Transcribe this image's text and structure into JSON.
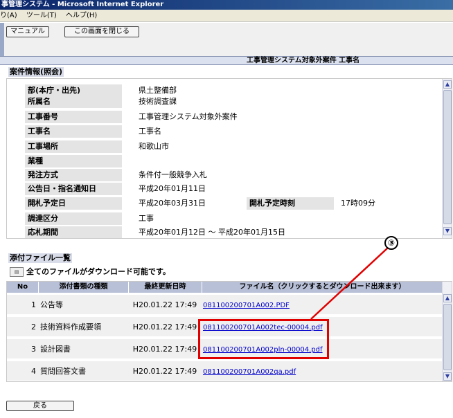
{
  "window": {
    "title": "事管理システム - Microsoft Internet Explorer"
  },
  "menu": [
    "り(A)",
    "ツール(T)",
    "ヘルプ(H)"
  ],
  "toolbar": {
    "manual_label": "マニュアル",
    "close_label": "この画面を閉じる"
  },
  "header": {
    "system_title": "工事管理システム対象外案件 工事名"
  },
  "case_info": {
    "title": "案件情報(照会)",
    "rows": [
      {
        "label": "部(本庁・出先)",
        "value": "県土整備部"
      },
      {
        "label": "所属名",
        "value": "技術調査課"
      },
      {
        "label": "工事番号",
        "value": "工事管理システム対象外案件"
      },
      {
        "label": "工事名",
        "value": "工事名"
      },
      {
        "label": "工事場所",
        "value": "和歌山市"
      },
      {
        "label": "業種",
        "value": ""
      },
      {
        "label": "発注方式",
        "value": "条件付一般競争入札"
      },
      {
        "label": "公告日・指名通知日",
        "value": "平成20年01月11日"
      },
      {
        "label": "開札予定日",
        "value": "平成20年03月31日"
      },
      {
        "label": "調達区分",
        "value": "工事"
      },
      {
        "label": "応札期間",
        "value": "平成20年01月12日 ～ 平成20年01月15日"
      }
    ],
    "open_time_label": "開札予定時刻",
    "open_time_value": "17時09分"
  },
  "attachments": {
    "title": "添付ファイル一覧",
    "download_note": "全てのファイルがダウンロード可能です。",
    "headers": [
      "No",
      "添付書類の種類",
      "最終更新日時",
      "ファイル名（クリックするとダウンロード出来ます）"
    ],
    "rows": [
      {
        "no": "1",
        "type": "公告等",
        "date": "H20.01.22 17:49",
        "file": "081100200701A002.PDF"
      },
      {
        "no": "2",
        "type": "技術資料作成要領",
        "date": "H20.01.22 17:49",
        "file": "081100200701A002tec-00004.pdf"
      },
      {
        "no": "3",
        "type": "設計図書",
        "date": "H20.01.22 17:49",
        "file": "081100200701A002pln-00004.pdf"
      },
      {
        "no": "4",
        "type": "質問回答文書",
        "date": "H20.01.22 17:49",
        "file": "081100200701A002qa.pdf"
      }
    ]
  },
  "annotation": {
    "callout": "③",
    "color": "#e00000"
  },
  "footer": {
    "back_label": "戻る"
  }
}
